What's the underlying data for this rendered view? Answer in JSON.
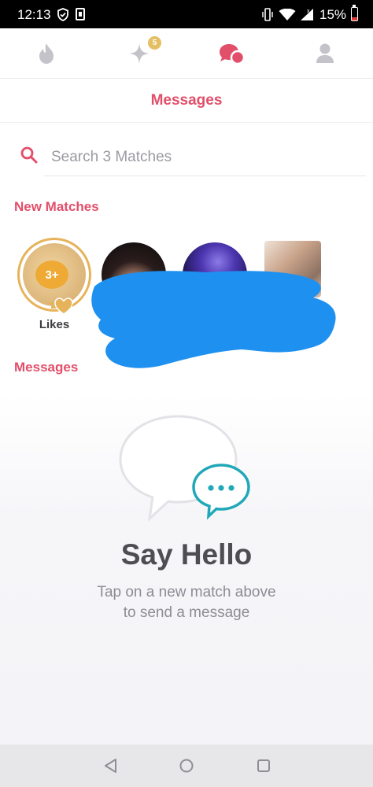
{
  "status_bar": {
    "time": "12:13",
    "battery": "15%",
    "icons": [
      "shield-check-icon",
      "sim-card-icon",
      "vibrate-icon",
      "wifi-icon",
      "signal-icon",
      "battery-icon"
    ]
  },
  "top_nav": {
    "items": [
      {
        "icon": "flame-icon",
        "active": false
      },
      {
        "icon": "sparkle-icon",
        "badge": "5",
        "active": false
      },
      {
        "icon": "chat-bubbles-icon",
        "active": true
      },
      {
        "icon": "profile-icon",
        "active": false
      }
    ]
  },
  "header": {
    "title": "Messages"
  },
  "search": {
    "placeholder": "Search 3 Matches",
    "value": ""
  },
  "new_matches": {
    "title": "New Matches",
    "likes": {
      "count": "3+",
      "label": "Likes"
    },
    "matches": [
      {
        "name": ""
      },
      {
        "name": ""
      },
      {
        "name": ""
      }
    ]
  },
  "messages": {
    "title": "Messages",
    "empty_title": "Say Hello",
    "empty_line1": "Tap on a new match above",
    "empty_line2": "to send a message"
  },
  "colors": {
    "accent": "#e24f6a",
    "gold": "#e6b35a",
    "teal": "#21a8b8",
    "muted": "#8c8c94"
  },
  "system_nav": {
    "buttons": [
      "back-icon",
      "home-icon",
      "recents-icon"
    ]
  }
}
